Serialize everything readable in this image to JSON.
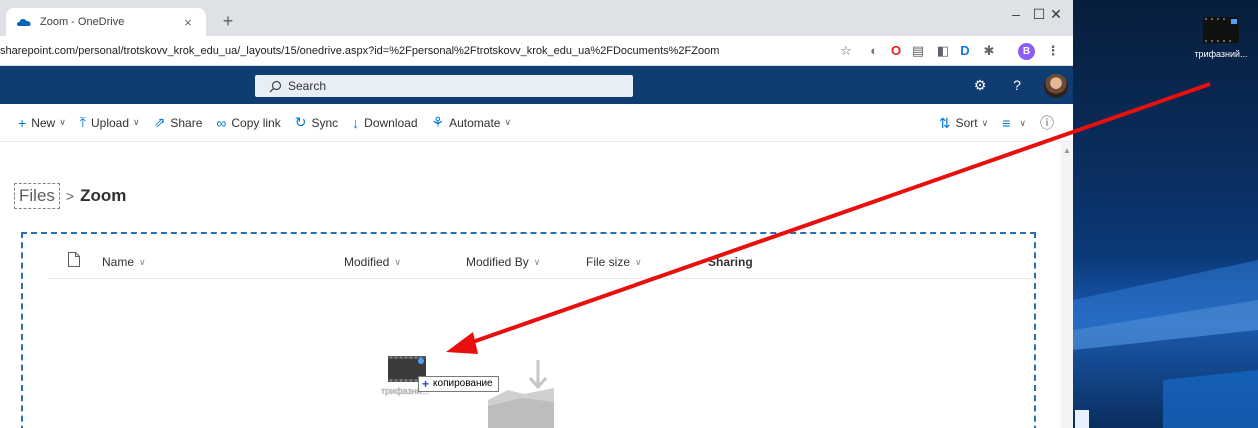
{
  "browser": {
    "tab_title": "Zoom - OneDrive",
    "tab_close": "×",
    "new_tab": "+",
    "window_controls": {
      "minimize": "–",
      "maximize": "☐",
      "close": "✕"
    },
    "url": "sharepoint.com/personal/trotskovv_krok_edu_ua/_layouts/15/onedrive.aspx?id=%2Fpersonal%2Ftrotskovv_krok_edu_ua%2FDocuments%2FZoom",
    "profile_initial": "B",
    "menu_glyph": "⋮"
  },
  "suitebar": {
    "search_placeholder": "Search",
    "help_glyph": "?",
    "color": "#0f3d72"
  },
  "commandbar": {
    "new": "New",
    "upload": "Upload",
    "share": "Share",
    "copy_link": "Copy link",
    "sync": "Sync",
    "download": "Download",
    "automate": "Automate",
    "sort": "Sort"
  },
  "breadcrumb": {
    "root": "Files",
    "separator": ">",
    "current": "Zoom"
  },
  "list": {
    "columns": [
      "Name",
      "Modified",
      "Modified By",
      "File size",
      "Sharing"
    ]
  },
  "drag": {
    "tooltip": "копирование",
    "tooltip_prefix": "+",
    "file_caption": "трифазни..."
  },
  "desktop": {
    "icon_label": "трифазний..."
  },
  "colors": {
    "accent": "#0078d4",
    "dropzone_border": "#2a6fb0",
    "annotation_arrow": "#e8100e"
  }
}
